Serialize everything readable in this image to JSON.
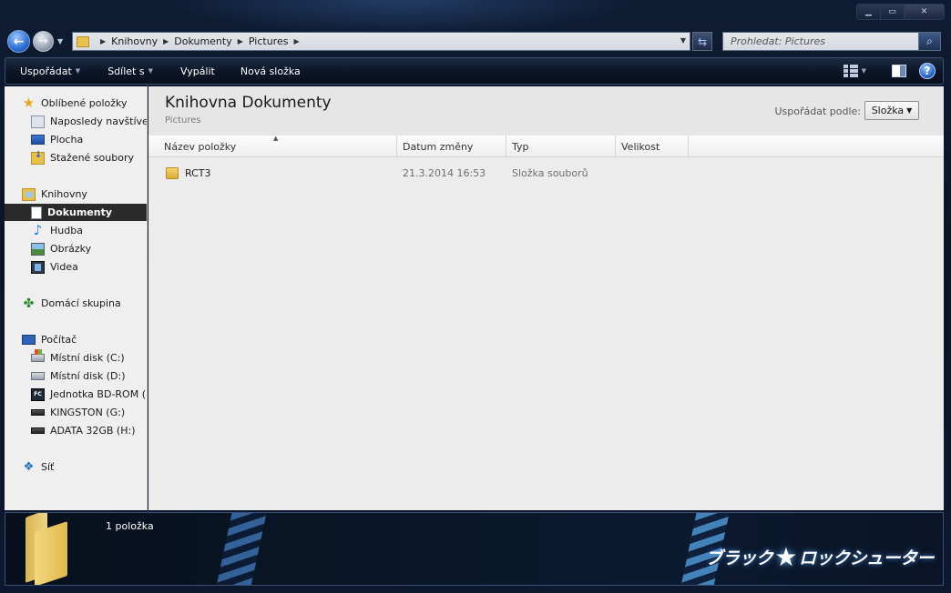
{
  "window": {
    "caption_buttons": [
      "minimize",
      "maximize",
      "close"
    ]
  },
  "address": {
    "crumbs": [
      "Knihovny",
      "Dokumenty",
      "Pictures"
    ]
  },
  "search": {
    "placeholder": "Prohledat: Pictures"
  },
  "toolbar": {
    "organize": "Uspořádat",
    "share": "Sdílet s",
    "burn": "Vypálit",
    "new_folder": "Nová složka"
  },
  "sidebar": {
    "favorites": "Oblíbené položky",
    "recent": "Naposledy navštíven",
    "desktop": "Plocha",
    "downloads": "Stažené soubory",
    "libraries": "Knihovny",
    "documents": "Dokumenty",
    "music": "Hudba",
    "pictures": "Obrázky",
    "videos": "Videa",
    "homegroup": "Domácí skupina",
    "computer": "Počítač",
    "disk_c": "Místní disk (C:)",
    "disk_d": "Místní disk (D:)",
    "bd_rom": "Jednotka BD-ROM (F",
    "kingston": "KINGSTON (G:)",
    "adata": "ADATA 32GB (H:)",
    "network": "Síť"
  },
  "library": {
    "title": "Knihovna Dokumenty",
    "subtitle": "Pictures",
    "arrange_label": "Uspořádat podle:",
    "arrange_value": "Složka"
  },
  "columns": {
    "name": "Název položky",
    "date": "Datum změny",
    "type": "Typ",
    "size": "Velikost"
  },
  "files": [
    {
      "name": "RCT3",
      "date": "21.3.2014 16:53",
      "type": "Složka souborů",
      "size": ""
    }
  ],
  "status": {
    "count": "1 položka"
  },
  "brand": {
    "left": "ブラック",
    "right": "ロックシューター"
  },
  "colors": {
    "frame": "#0b1526",
    "selected_nav": "#2b2b2b",
    "folder": "#e8c14d"
  }
}
